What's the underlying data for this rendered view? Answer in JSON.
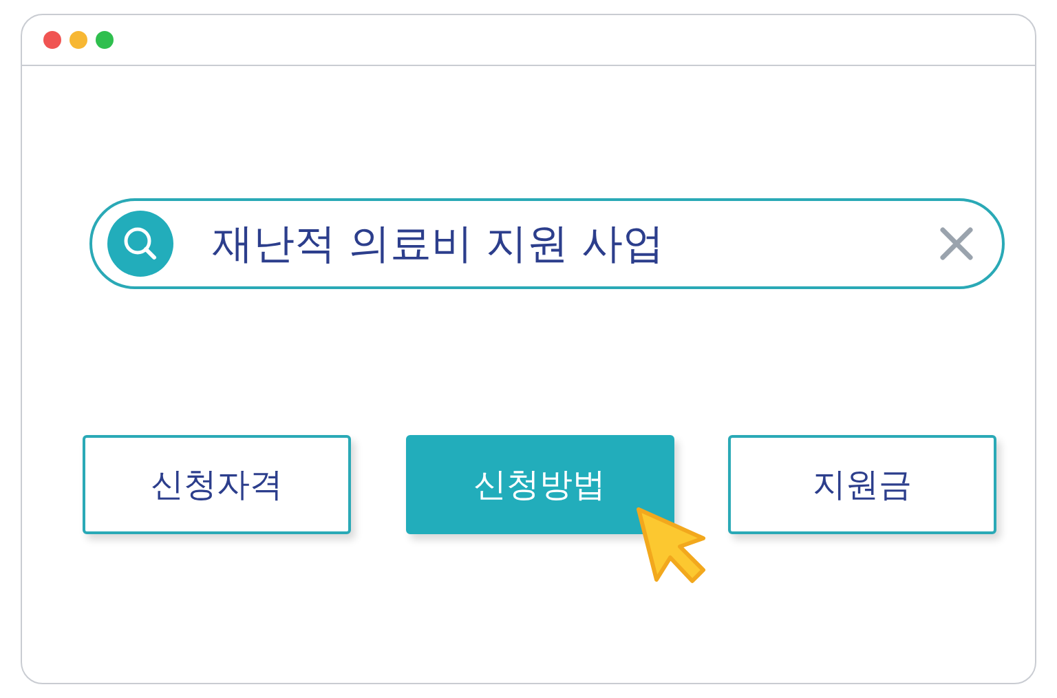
{
  "search": {
    "value": "재난적 의료비 지원 사업"
  },
  "buttons": [
    {
      "label": "신청자격",
      "selected": false
    },
    {
      "label": "신청방법",
      "selected": true
    },
    {
      "label": "지원금",
      "selected": false
    }
  ]
}
